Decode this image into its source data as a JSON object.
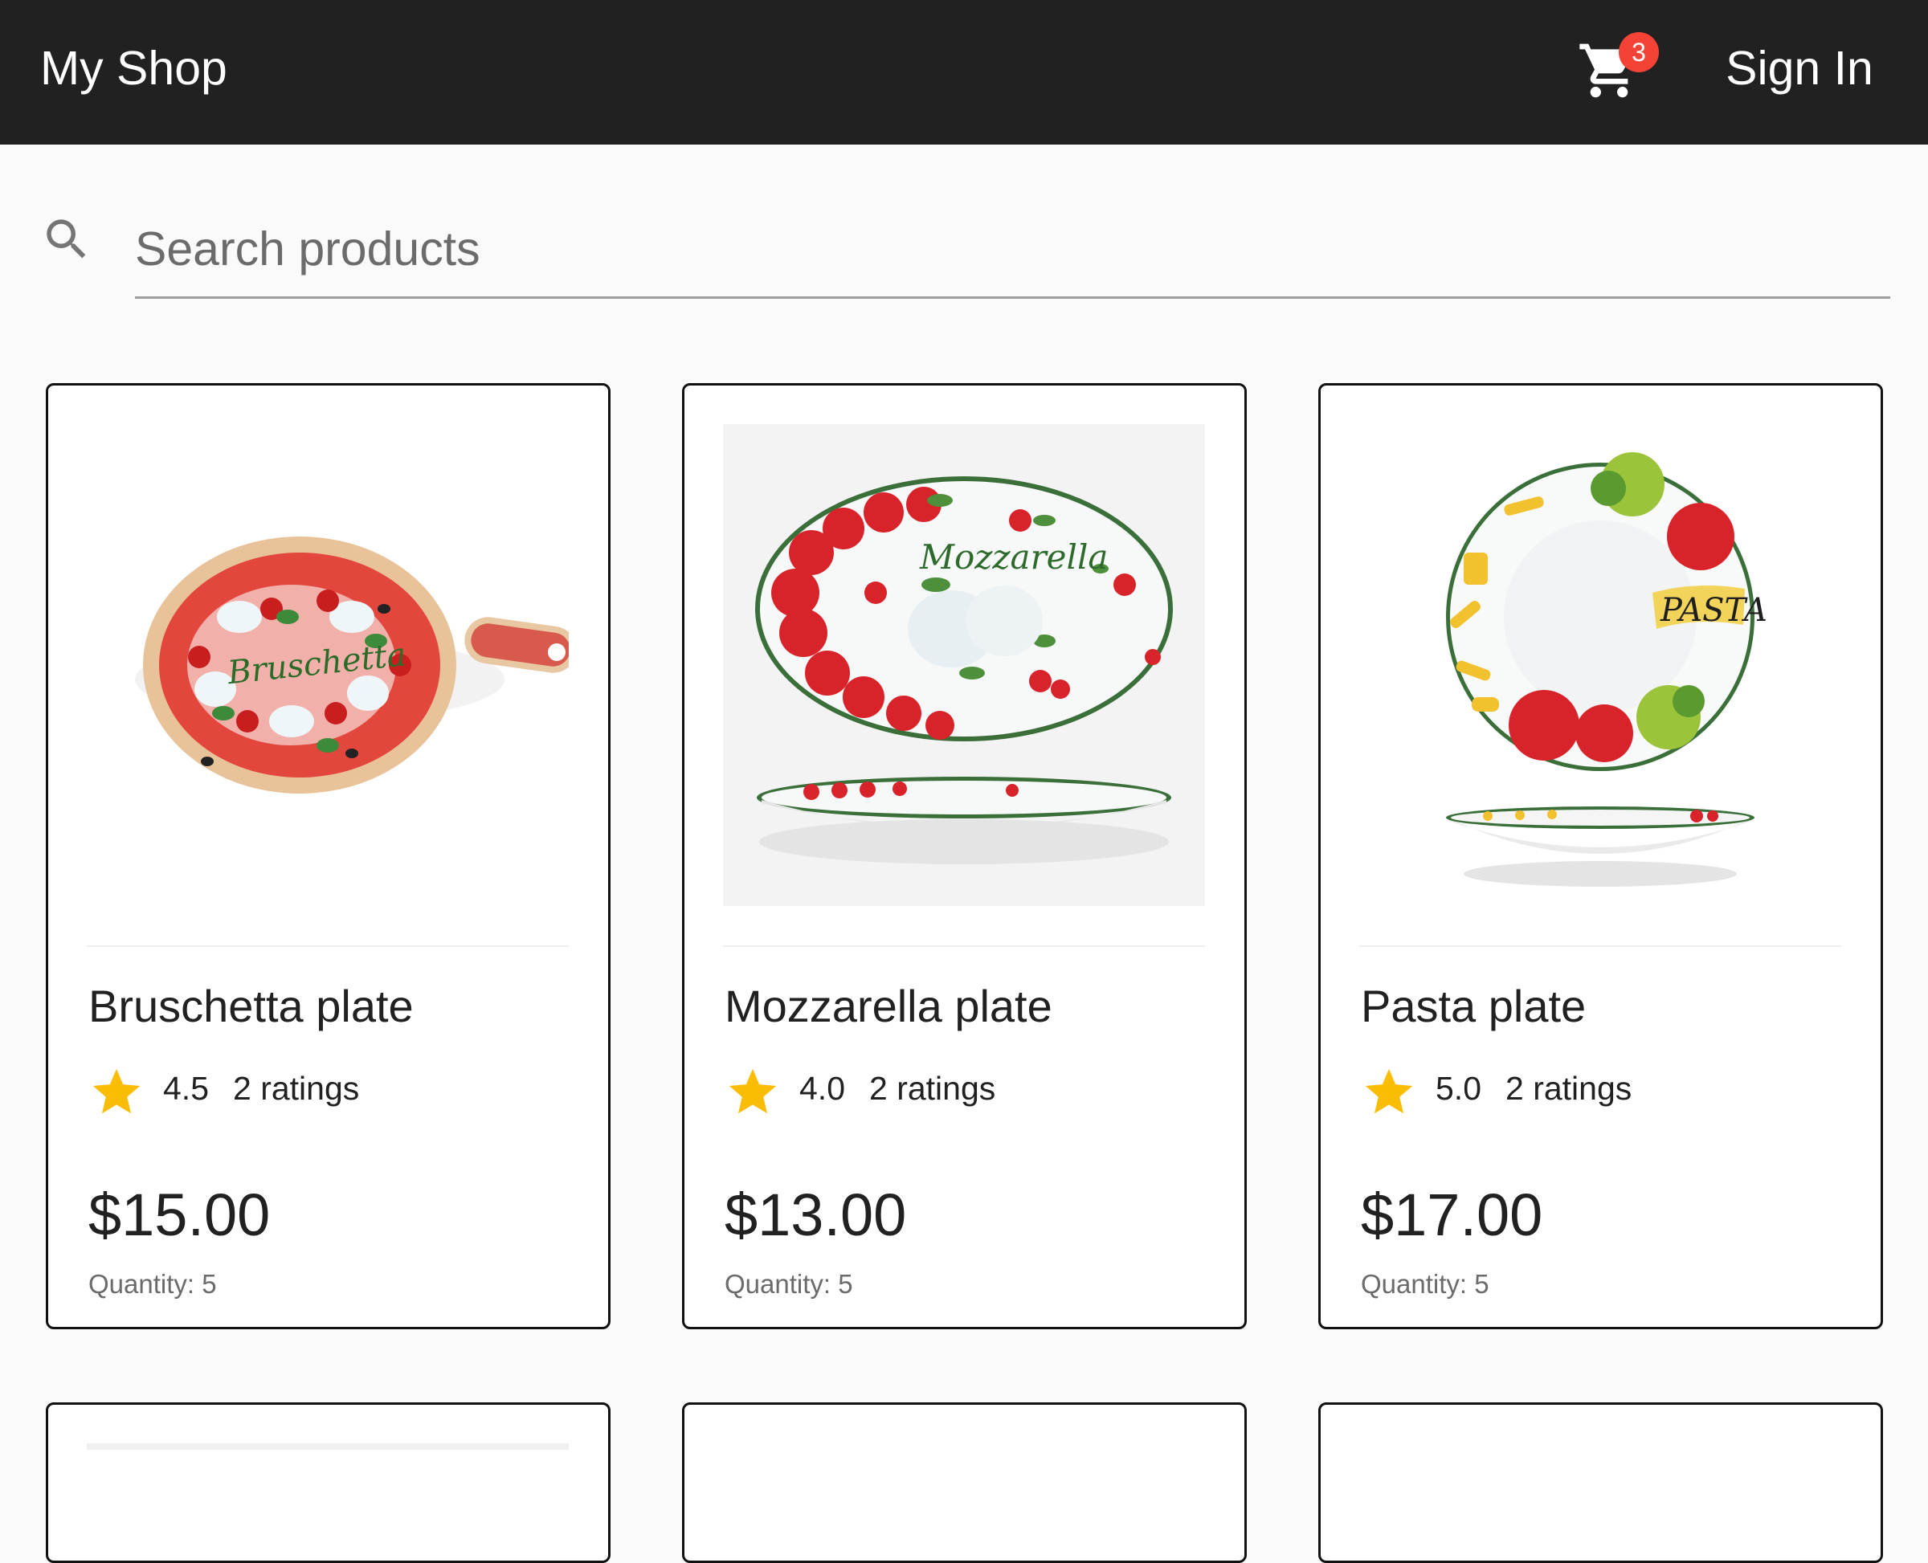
{
  "header": {
    "brand": "My Shop",
    "cart_icon": "shopping-cart-icon",
    "cart_count": "3",
    "sign_in": "Sign In",
    "background": "#212121",
    "badge_color": "#f44336"
  },
  "search": {
    "icon": "search-icon",
    "placeholder": "Search products",
    "value": ""
  },
  "products": [
    {
      "name": "Bruschetta plate",
      "rating": "4.5",
      "ratings_count": "2 ratings",
      "price": "$15.00",
      "quantity": "Quantity: 5",
      "image": "bruschetta-plate-image"
    },
    {
      "name": "Mozzarella plate",
      "rating": "4.0",
      "ratings_count": "2 ratings",
      "price": "$13.00",
      "quantity": "Quantity: 5",
      "image": "mozzarella-plate-image"
    },
    {
      "name": "Pasta plate",
      "rating": "5.0",
      "ratings_count": "2 ratings",
      "price": "$17.00",
      "quantity": "Quantity: 5",
      "image": "pasta-plate-image"
    }
  ],
  "star_color": "#fbbc04"
}
